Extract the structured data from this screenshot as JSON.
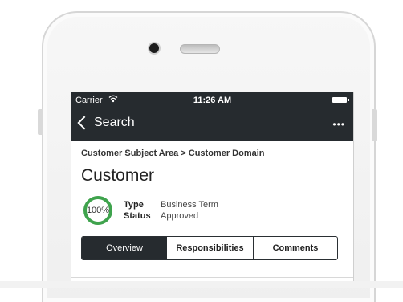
{
  "status_bar": {
    "carrier": "Carrier",
    "wifi_icon": "wifi-icon",
    "time": "11:26 AM",
    "battery_icon": "battery-icon"
  },
  "nav": {
    "back_label": "Search",
    "back_icon": "chevron-left-icon",
    "more_label": "•••"
  },
  "page": {
    "breadcrumb": "Customer Subject Area > Customer Domain",
    "title": "Customer",
    "progress": "100%",
    "progress_value": 1.0,
    "progress_color": "#3fa34d",
    "details": [
      {
        "key": "Type",
        "value": "Business Term"
      },
      {
        "key": "Status",
        "value": "Approved"
      }
    ]
  },
  "tabs": [
    {
      "label": "Overview",
      "active": true
    },
    {
      "label": "Responsibilities",
      "active": false
    },
    {
      "label": "Comments",
      "active": false
    }
  ],
  "colors": {
    "header_bg": "#262b2f",
    "accent_green": "#3fa34d"
  }
}
